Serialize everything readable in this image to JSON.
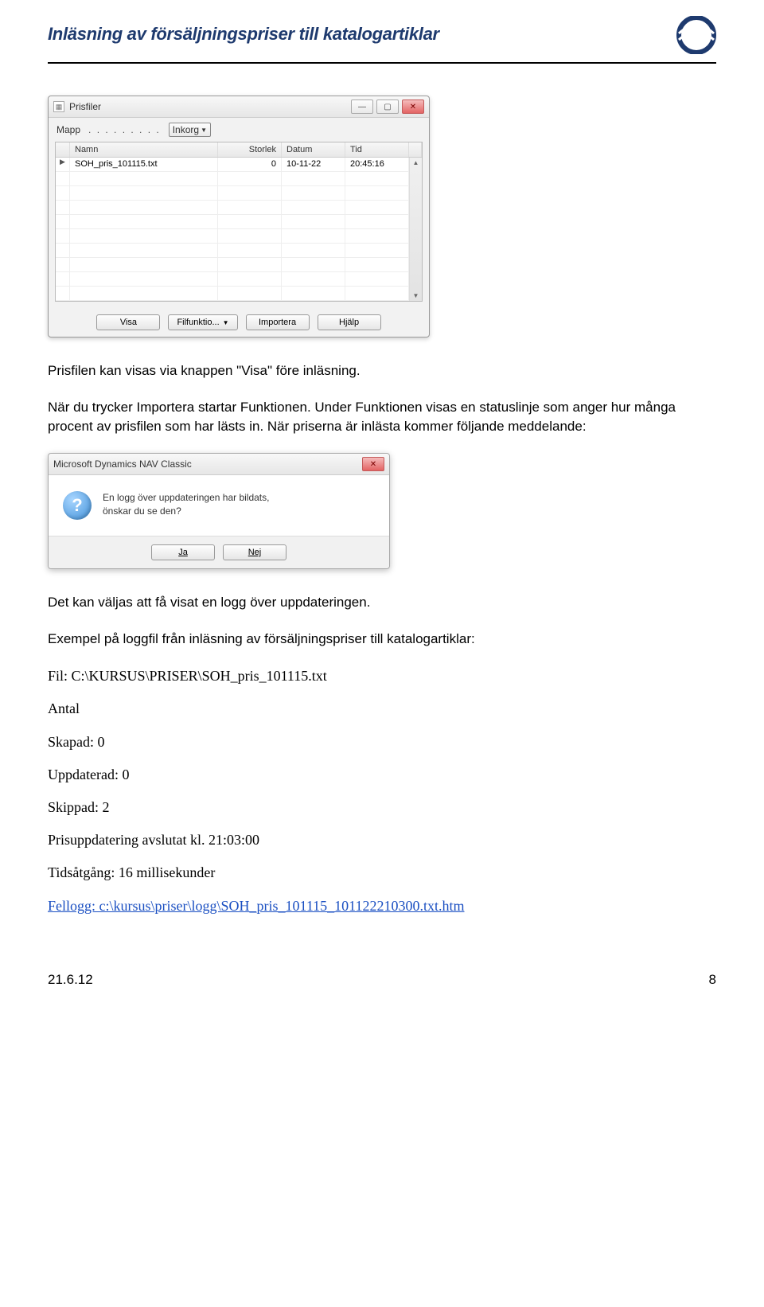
{
  "header": {
    "title": "Inläsning av försäljningspriser till katalogartiklar"
  },
  "prisfiler": {
    "title": "Prisfiler",
    "folder_label": "Mapp",
    "folder_value": "Inkorg",
    "columns": {
      "name": "Namn",
      "size": "Storlek",
      "date": "Datum",
      "time": "Tid"
    },
    "row": {
      "name": "SOH_pris_101115.txt",
      "size": "0",
      "date": "10-11-22",
      "time": "20:45:16"
    },
    "buttons": {
      "visa": "Visa",
      "fil": "Filfunktio...",
      "importera": "Importera",
      "hjalp": "Hjälp"
    }
  },
  "body": {
    "p1": "Prisfilen kan visas via knappen \"Visa\" före inläsning.",
    "p2": "När du trycker Importera startar Funktionen. Under Funktionen visas en statuslinje som anger hur många procent av prisfilen som har lästs in. När priserna är inlästa kommer följande meddelande:"
  },
  "dialog": {
    "title": "Microsoft Dynamics NAV Classic",
    "text1": "En logg över uppdateringen har bildats,",
    "text2": "önskar du se den?",
    "yes": "Ja",
    "no": "Nej"
  },
  "body2": {
    "p3": "Det kan väljas att få visat en logg över uppdateringen.",
    "p4": "Exempel på loggfil från inläsning av försäljningspriser till katalogartiklar:"
  },
  "log": {
    "file": "Fil: C:\\KURSUS\\PRISER\\SOH_pris_101115.txt",
    "antal": "Antal",
    "skapad": "Skapad: 0",
    "uppdaterad": "Uppdaterad: 0",
    "skippad": "Skippad: 2",
    "avslutat": "Prisuppdatering avslutat kl. 21:03:00",
    "tids": "Tidsåtgång: 16 millisekunder",
    "fellogg": "Fellogg: c:\\kursus\\priser\\logg\\SOH_pris_101115_101122210300.txt.htm"
  },
  "footer": {
    "date": "21.6.12",
    "page": "8"
  }
}
